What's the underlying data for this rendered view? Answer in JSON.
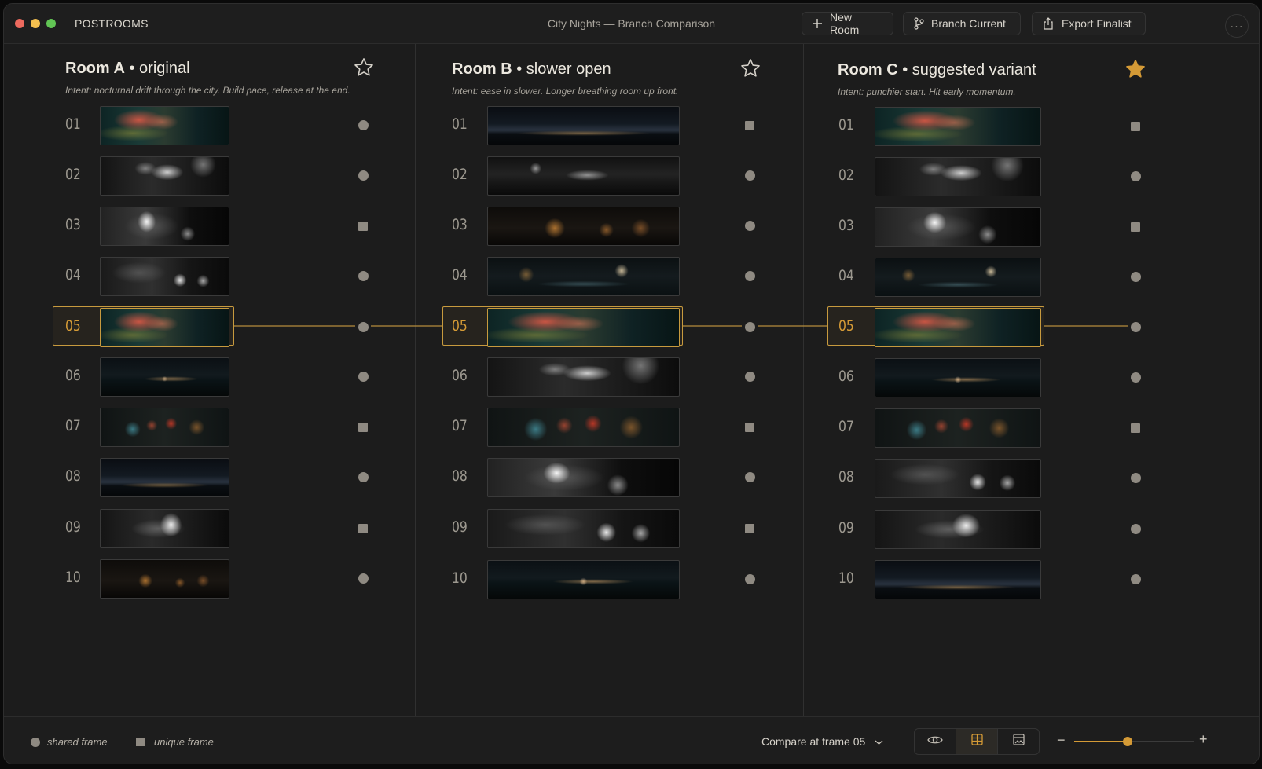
{
  "window": {
    "app_name": "POSTROOMS",
    "doc_title": "City Nights — Branch Comparison",
    "traffic_colors": [
      "#ed6a5e",
      "#f4bf4f",
      "#61c554"
    ]
  },
  "toolbar": {
    "new_room": "New Room",
    "branch_current": "Branch Current",
    "export_finalist": "Export Finalist",
    "more": "···"
  },
  "accent": "#d49a36",
  "selected_frame": "05",
  "rooms": [
    {
      "name": "Room A",
      "variant": "original",
      "intent": "Intent: nocturnal drift through the city. Build pace, release at the end.",
      "starred": false,
      "frames": [
        {
          "num": "01",
          "thumb": "neon-blur",
          "marker": "shared"
        },
        {
          "num": "02",
          "thumb": "crowd-night",
          "marker": "shared"
        },
        {
          "num": "03",
          "thumb": "flare-figure",
          "marker": "unique"
        },
        {
          "num": "04",
          "thumb": "street-crowd",
          "marker": "shared"
        },
        {
          "num": "05",
          "thumb": "neon-blur",
          "marker": "shared"
        },
        {
          "num": "06",
          "thumb": "dark-road",
          "marker": "shared"
        },
        {
          "num": "07",
          "thumb": "rain-lights",
          "marker": "unique"
        },
        {
          "num": "08",
          "thumb": "skyline",
          "marker": "shared"
        },
        {
          "num": "09",
          "thumb": "light-streak",
          "marker": "unique"
        },
        {
          "num": "10",
          "thumb": "warm-street",
          "marker": "shared"
        }
      ]
    },
    {
      "name": "Room B",
      "variant": "slower open",
      "intent": "Intent: ease in slower. Longer breathing room up front.",
      "starred": false,
      "frames": [
        {
          "num": "01",
          "thumb": "skyline",
          "marker": "unique"
        },
        {
          "num": "02",
          "thumb": "foggy-road",
          "marker": "shared"
        },
        {
          "num": "03",
          "thumb": "warm-street",
          "marker": "shared"
        },
        {
          "num": "04",
          "thumb": "wet-street",
          "marker": "shared"
        },
        {
          "num": "05",
          "thumb": "neon-blur",
          "marker": "shared"
        },
        {
          "num": "06",
          "thumb": "crowd-night",
          "marker": "shared"
        },
        {
          "num": "07",
          "thumb": "rain-lights",
          "marker": "unique"
        },
        {
          "num": "08",
          "thumb": "flare-figure",
          "marker": "shared"
        },
        {
          "num": "09",
          "thumb": "street-crowd",
          "marker": "unique"
        },
        {
          "num": "10",
          "thumb": "dark-road",
          "marker": "shared"
        }
      ]
    },
    {
      "name": "Room C",
      "variant": "suggested variant",
      "intent": "Intent: punchier start. Hit early momentum.",
      "starred": true,
      "frames": [
        {
          "num": "01",
          "thumb": "neon-blur",
          "marker": "unique"
        },
        {
          "num": "02",
          "thumb": "crowd-night",
          "marker": "shared"
        },
        {
          "num": "03",
          "thumb": "flare-figure",
          "marker": "unique"
        },
        {
          "num": "04",
          "thumb": "wet-street",
          "marker": "shared"
        },
        {
          "num": "05",
          "thumb": "neon-blur",
          "marker": "shared"
        },
        {
          "num": "06",
          "thumb": "dark-road",
          "marker": "shared"
        },
        {
          "num": "07",
          "thumb": "rain-lights",
          "marker": "unique"
        },
        {
          "num": "08",
          "thumb": "street-crowd",
          "marker": "shared"
        },
        {
          "num": "09",
          "thumb": "light-streak",
          "marker": "shared"
        },
        {
          "num": "10",
          "thumb": "skyline",
          "marker": "shared"
        }
      ]
    }
  ],
  "legend": {
    "shared": "shared frame",
    "unique": "unique frame"
  },
  "footer": {
    "compare_label": "Compare at frame 05",
    "view_modes": [
      "eye-icon",
      "grid-icon",
      "image-icon"
    ],
    "active_view": "grid-icon",
    "zoom_level": 0.45,
    "zoom_minus": "−",
    "zoom_plus": "+"
  }
}
